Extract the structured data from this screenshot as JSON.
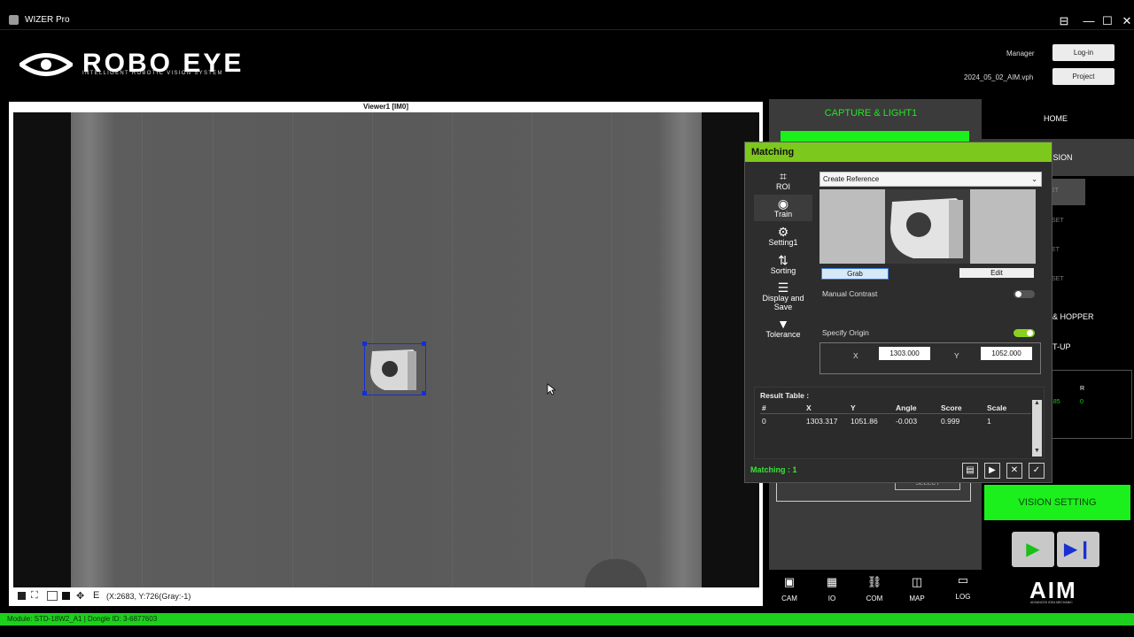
{
  "window": {
    "title": "WIZER Pro",
    "controls": [
      "⊟",
      "—",
      "☐",
      "✕"
    ]
  },
  "brand": {
    "name": "ROBO EYE",
    "tagline": "INTELLIGENT ROBOTIC VISION SYSTEM",
    "footer_logo": "AIM",
    "footer_tagline": "ADVANCED IDEA MECHANIC"
  },
  "header": {
    "user": "Manager",
    "login_label": "Log-in",
    "project_file": "2024_05_02_AIM.vph",
    "project_label": "Project"
  },
  "viewer": {
    "title": "Viewer1 [IM0]",
    "tool_letter": "E",
    "cursor_readout": "(X:2683, Y:726(Gray:-1)"
  },
  "capture_panel": {
    "title": "CAPTURE & LIGHT1",
    "select_label": "SELECT"
  },
  "menu": {
    "items": [
      "HOME",
      "ISION",
      "ET",
      "SET",
      "ET",
      "SET",
      "& HOPPER",
      "T-UP"
    ],
    "mini_header": "R",
    "mini_values": [
      "185",
      "0"
    ],
    "vision_setting": "VISION SETTING"
  },
  "bottom_nav": [
    {
      "label": "CAM",
      "icon": "camera-icon"
    },
    {
      "label": "IO",
      "icon": "io-icon"
    },
    {
      "label": "COM",
      "icon": "link-icon"
    },
    {
      "label": "MAP",
      "icon": "map-icon"
    },
    {
      "label": "LOG",
      "icon": "log-icon"
    }
  ],
  "dialog": {
    "title": "Matching",
    "side": [
      {
        "label": "ROI",
        "icon": "crop-icon"
      },
      {
        "label": "Train",
        "icon": "train-icon"
      },
      {
        "label": "Setting1",
        "icon": "gear-icon"
      },
      {
        "label": "Sorting",
        "icon": "sort-icon"
      },
      {
        "label": "Display and Save",
        "icon": "list-icon"
      },
      {
        "label": "Tolerance",
        "icon": "funnel-icon"
      }
    ],
    "mode": "Create Reference",
    "grab_label": "Grab",
    "edit_label": "Edit",
    "manual_contrast_label": "Manual Contrast",
    "manual_contrast_on": false,
    "specify_origin_label": "Specify Origin",
    "specify_origin_on": true,
    "origin_x_label": "X",
    "origin_x": "1303.000",
    "origin_y_label": "Y",
    "origin_y": "1052.000",
    "result_title": "Result Table :",
    "result_columns": [
      "#",
      "X",
      "Y",
      "Angle",
      "Score",
      "Scale"
    ],
    "result_rows": [
      [
        "0",
        "1303.317",
        "1051.86",
        "-0.003",
        "0.999",
        "1"
      ]
    ],
    "matching_status": "Matching : 1",
    "accent": "#7dc81c"
  },
  "module_bar": "Module: STD-18W2_A1 | Dongle ID: 3-6877603"
}
